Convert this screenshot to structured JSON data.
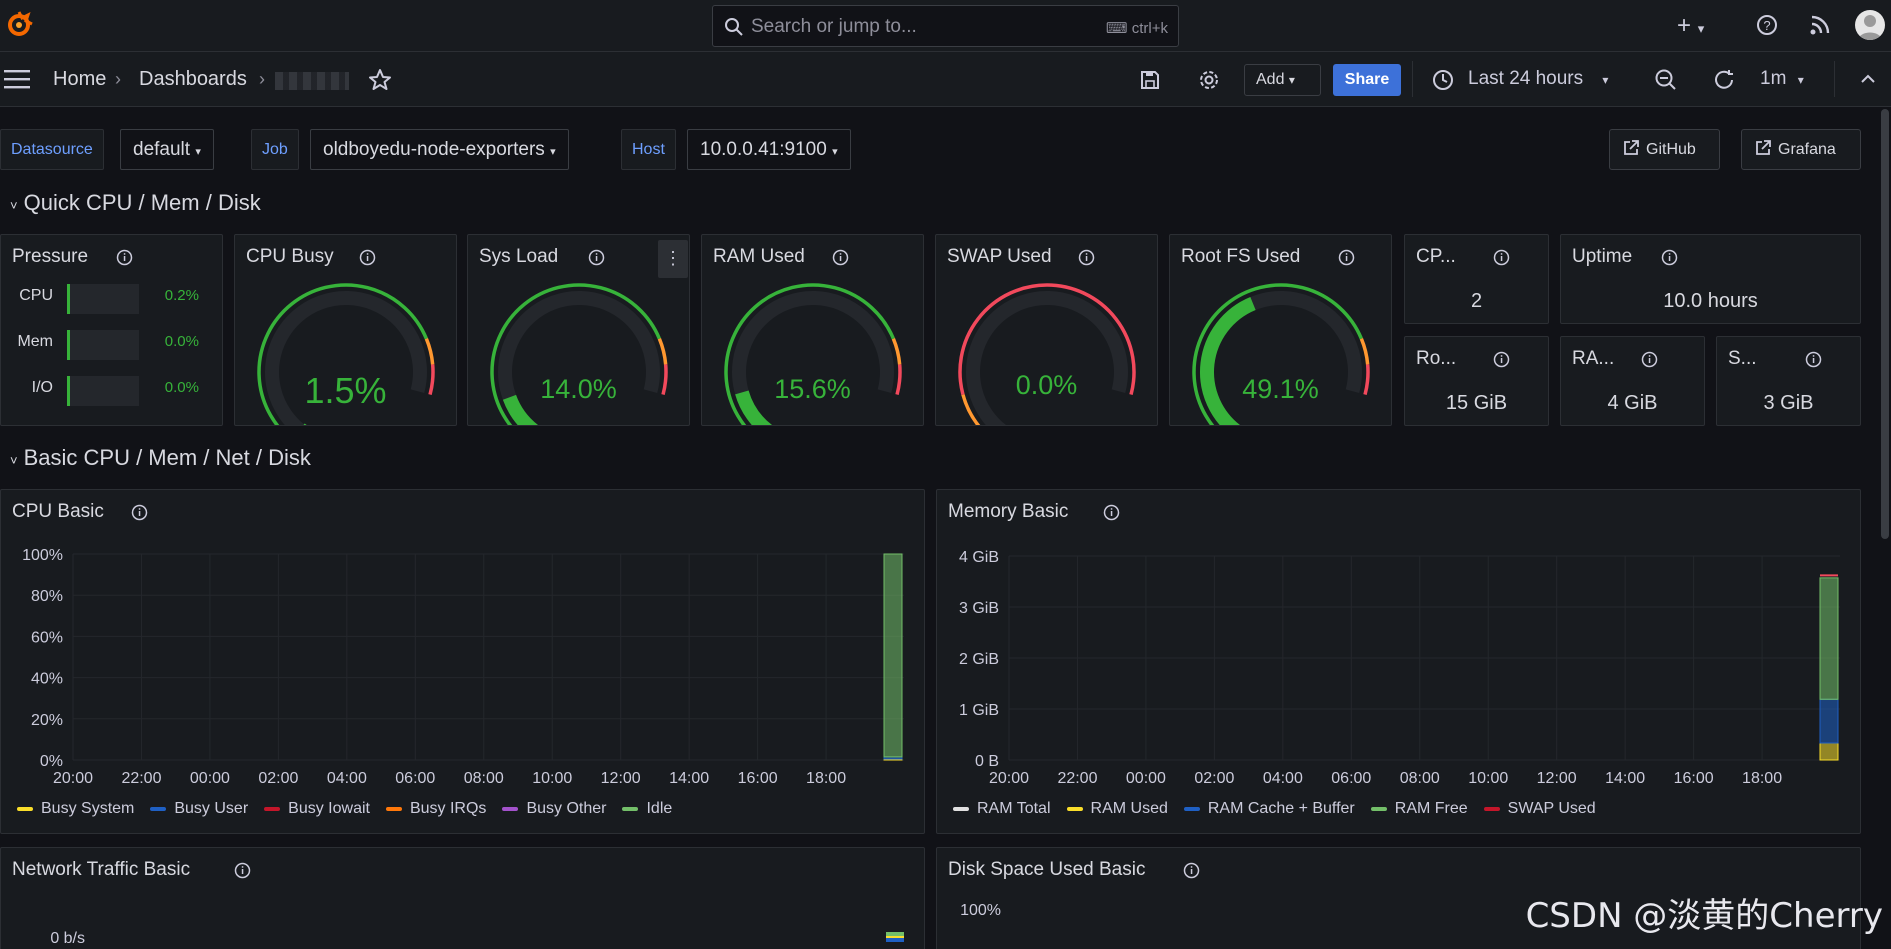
{
  "topbar": {
    "search_placeholder": "Search or jump to...",
    "search_shortcut": "ctrl+k"
  },
  "navbar": {
    "breadcrumbs": [
      "Home",
      "Dashboards"
    ],
    "add_label": "Add",
    "share_label": "Share",
    "time_range": "Last 24 hours",
    "refresh_interval": "1m"
  },
  "variables": {
    "datasource": {
      "label": "Datasource",
      "value": "default"
    },
    "job": {
      "label": "Job",
      "value": "oldboyedu-node-exporters"
    },
    "host": {
      "label": "Host",
      "value": "10.0.0.41:9100"
    },
    "links": [
      "GitHub",
      "Grafana"
    ]
  },
  "rows": {
    "quick": "Quick CPU / Mem / Disk",
    "basic": "Basic CPU / Mem / Net / Disk"
  },
  "pressure": {
    "title": "Pressure",
    "items": [
      {
        "label": "CPU",
        "value": "0.2%"
      },
      {
        "label": "Mem",
        "value": "0.0%"
      },
      {
        "label": "I/O",
        "value": "0.0%"
      }
    ]
  },
  "gauges": [
    {
      "title": "CPU Busy",
      "value": "1.5%",
      "fraction": 0.015
    },
    {
      "title": "Sys Load",
      "value": "14.0%",
      "fraction": 0.14
    },
    {
      "title": "RAM Used",
      "value": "15.6%",
      "fraction": 0.156
    },
    {
      "title": "SWAP Used",
      "value": "0.0%",
      "fraction": 0.0
    },
    {
      "title": "Root FS Used",
      "value": "49.1%",
      "fraction": 0.491
    }
  ],
  "stats": {
    "cpu_cores": {
      "title": "CP...",
      "value": "2"
    },
    "uptime": {
      "title": "Uptime",
      "value": "10.0 hours"
    },
    "rootfs_total": {
      "title": "Ro...",
      "value": "15 GiB"
    },
    "ram_total": {
      "title": "RA...",
      "value": "4 GiB"
    },
    "swap_total": {
      "title": "S...",
      "value": "3 GiB"
    }
  },
  "panels": {
    "cpu_basic": "CPU Basic",
    "memory_basic": "Memory Basic",
    "network_basic": "Network Traffic Basic",
    "disk_basic": "Disk Space Used Basic"
  },
  "colors": {
    "accent": "#3d71d9",
    "green": "#37b33a",
    "red": "#f2495c",
    "orange": "#ff9830",
    "yellow": "#fade2a"
  },
  "watermark": "CSDN @淡黄的Cherry",
  "chart_data": [
    {
      "type": "area",
      "title": "CPU Basic",
      "x": [
        "20:00",
        "22:00",
        "00:00",
        "02:00",
        "04:00",
        "06:00",
        "08:00",
        "10:00",
        "12:00",
        "14:00",
        "16:00",
        "18:00"
      ],
      "ytick_labels": [
        "0%",
        "20%",
        "40%",
        "60%",
        "80%",
        "100%"
      ],
      "ylim": [
        0,
        100
      ],
      "series": [
        {
          "name": "Busy System",
          "color": "#fade2a",
          "last": 0.5
        },
        {
          "name": "Busy User",
          "color": "#1f60c4",
          "last": 1
        },
        {
          "name": "Busy Iowait",
          "color": "#c4162a",
          "last": 0
        },
        {
          "name": "Busy IRQs",
          "color": "#ff780a",
          "last": 0
        },
        {
          "name": "Busy Other",
          "color": "#a352cc",
          "last": 0
        },
        {
          "name": "Idle",
          "color": "#73bf69",
          "last": 98.5
        }
      ]
    },
    {
      "type": "area",
      "title": "Memory Basic",
      "x": [
        "20:00",
        "22:00",
        "00:00",
        "02:00",
        "04:00",
        "06:00",
        "08:00",
        "10:00",
        "12:00",
        "14:00",
        "16:00",
        "18:00"
      ],
      "ytick_labels": [
        "0 B",
        "1 GiB",
        "2 GiB",
        "3 GiB",
        "4 GiB"
      ],
      "ylim": [
        0,
        4.2
      ],
      "series": [
        {
          "name": "RAM Total",
          "color": "#e0e0e0",
          "last": 3.8
        },
        {
          "name": "RAM Used",
          "color": "#fade2a",
          "last": 0.35
        },
        {
          "name": "RAM Cache + Buffer",
          "color": "#1f60c4",
          "last": 0.9
        },
        {
          "name": "RAM Free",
          "color": "#73bf69",
          "last": 2.5
        },
        {
          "name": "SWAP Used",
          "color": "#c4162a",
          "last": 0
        }
      ]
    },
    {
      "type": "area",
      "title": "Network Traffic Basic",
      "ytick_labels": [
        "0 b/s"
      ]
    },
    {
      "type": "area",
      "title": "Disk Space Used Basic",
      "ytick_labels": [
        "100%"
      ]
    }
  ]
}
